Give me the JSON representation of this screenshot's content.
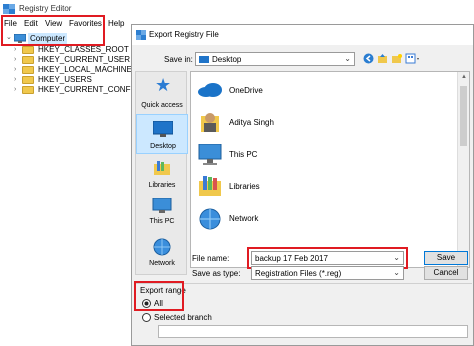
{
  "registry": {
    "title": "Registry Editor",
    "menu": [
      "File",
      "Edit",
      "View",
      "Favorites",
      "Help"
    ],
    "tree_root": "Computer",
    "keys": [
      "HKEY_CLASSES_ROOT",
      "HKEY_CURRENT_USER",
      "HKEY_LOCAL_MACHINE",
      "HKEY_USERS",
      "HKEY_CURRENT_CONFIG"
    ]
  },
  "dialog": {
    "title": "Export Registry File",
    "save_in_label": "Save in:",
    "save_in_value": "Desktop",
    "places": [
      "Quick access",
      "Desktop",
      "Libraries",
      "This PC",
      "Network"
    ],
    "items": [
      "OneDrive",
      "Aditya Singh",
      "This PC",
      "Libraries",
      "Network"
    ],
    "file_name_label": "File name:",
    "file_name_value": "backup 17 Feb 2017",
    "save_as_label": "Save as type:",
    "save_as_value": "Registration Files (*.reg)",
    "save_button": "Save",
    "cancel_button": "Cancel",
    "export_range_label": "Export range",
    "all_label": "All",
    "selected_branch_label": "Selected branch",
    "all_selected": true
  },
  "colors": {
    "highlight": "#e01b22",
    "selection": "#cce8ff",
    "accent": "#0078d7"
  }
}
